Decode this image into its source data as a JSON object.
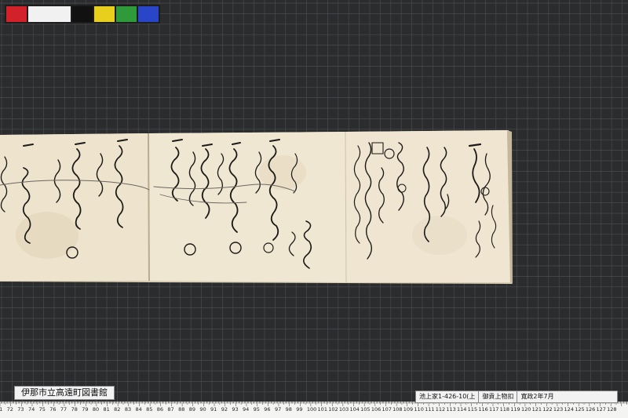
{
  "colors": {
    "background": "#2b2c2e",
    "grid_line": "#4a4b4e",
    "paper": "#efe6d2",
    "ink": "#1c1a18",
    "color_chart": [
      "#d3212a",
      "#f1f1f1",
      "#111111",
      "#e8cf1d",
      "#2f9a3a",
      "#2a46c8"
    ]
  },
  "labels": {
    "library": "伊那市立高遠町図書館",
    "catalog_id": "池上家1-426-10(上",
    "catalog_title": "御貢上物扣",
    "catalog_date": "寛政2年7月"
  },
  "ruler": {
    "numbers": [
      "71",
      "72",
      "73",
      "74",
      "75",
      "76",
      "77",
      "78",
      "79",
      "80",
      "81",
      "82",
      "83",
      "84",
      "85",
      "86",
      "87",
      "88",
      "89",
      "90",
      "91",
      "92",
      "93",
      "94",
      "95",
      "96",
      "97",
      "98",
      "99",
      "100",
      "101",
      "102",
      "103",
      "104",
      "105",
      "106",
      "107",
      "108",
      "109",
      "110",
      "111",
      "112",
      "113",
      "114",
      "115",
      "116",
      "117",
      "118",
      "119",
      "120",
      "121",
      "122",
      "123",
      "124",
      "125",
      "126",
      "127",
      "128"
    ]
  }
}
